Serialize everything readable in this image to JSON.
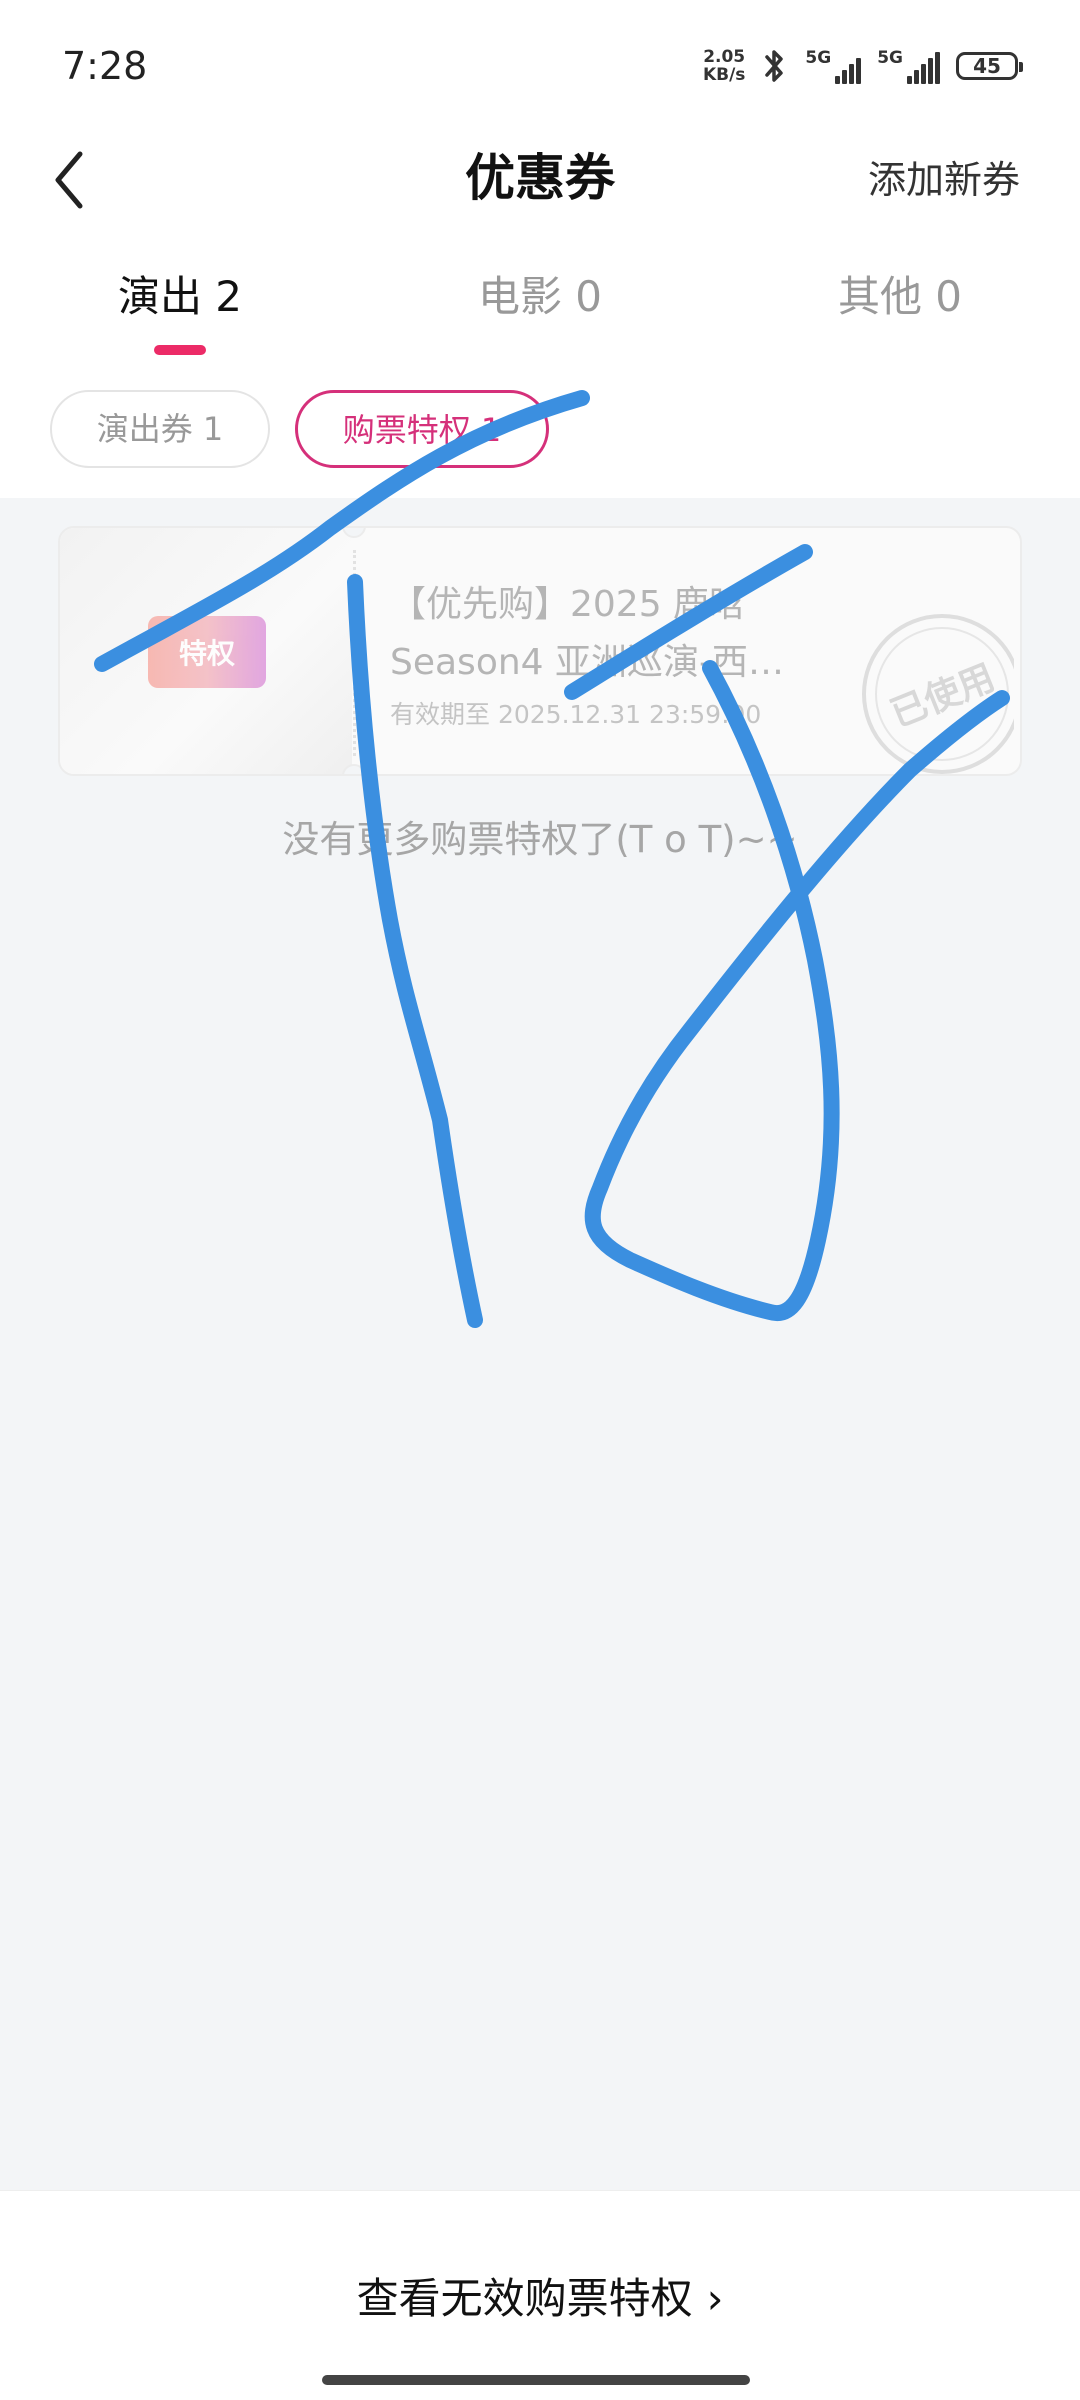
{
  "status_bar": {
    "time": "7:28",
    "net_speed_value": "2.05",
    "net_speed_unit": "KB/s",
    "sim1_label": "5G",
    "sim2_label": "5G",
    "battery": "45",
    "icons": [
      "bluetooth-icon",
      "signal-icon",
      "battery-icon"
    ]
  },
  "nav": {
    "title": "优惠券",
    "back_icon": "chevron-left-icon",
    "add_label": "添加新券"
  },
  "tabs": [
    {
      "label": "演出 2",
      "active": true
    },
    {
      "label": "电影 0",
      "active": false
    },
    {
      "label": "其他 0",
      "active": false
    }
  ],
  "chips": [
    {
      "label": "演出券 1",
      "active": false
    },
    {
      "label": "购票特权 1",
      "active": true
    }
  ],
  "coupons": [
    {
      "badge": "特权",
      "title": "【优先购】2025 鹿晗 Season4 亚洲巡演-西…",
      "expiry": "有效期至 2025.12.31 23:59:00",
      "stamp": "已使用"
    }
  ],
  "list_end_text": "没有更多购票特权了(T o T)~~",
  "bottom": {
    "view_invalid_label": "查看无效购票特权",
    "chevron": "›"
  },
  "colors": {
    "accent": "#ec2b67",
    "chip_active": "#d5307a",
    "scribble": "#3b8fe0",
    "background": "#f3f5f7"
  }
}
